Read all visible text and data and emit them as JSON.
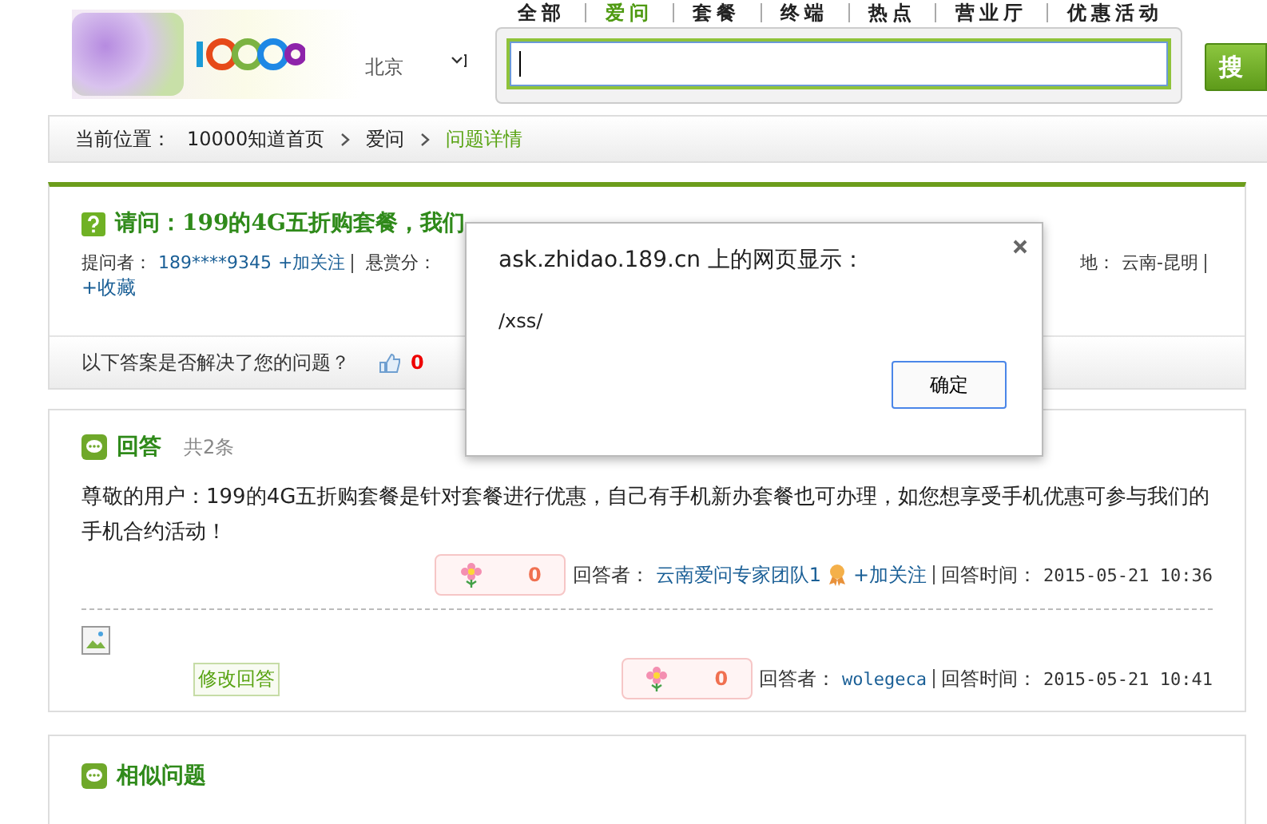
{
  "nav_tabs": [
    {
      "label": "全部",
      "selected": false
    },
    {
      "label": "爱问",
      "selected": true
    },
    {
      "label": "套餐",
      "selected": false
    },
    {
      "label": "终端",
      "selected": false
    },
    {
      "label": "热点",
      "selected": false
    },
    {
      "label": "营业厅",
      "selected": false
    },
    {
      "label": "优惠活动",
      "selected": false
    }
  ],
  "city_select": {
    "value": "北京"
  },
  "search": {
    "button": "搜"
  },
  "breadcrumb": {
    "label": "当前位置：",
    "items": [
      {
        "text": "10000知道首页",
        "current": false
      },
      {
        "text": "爱问",
        "current": false
      },
      {
        "text": "问题详情",
        "current": true
      }
    ]
  },
  "question": {
    "title": "请问：199的4G五折购套餐，我们",
    "asker_label": "提问者：",
    "asker": "189****9345",
    "follow": "+加关注",
    "reward_label": "悬赏分：",
    "location_label": "地：",
    "location": "云南-昆明",
    "favorite": "+收藏",
    "solved_prompt": "以下答案是否解决了您的问题？",
    "likes": "0"
  },
  "answers": {
    "title": "回答",
    "count": "共2条",
    "items": [
      {
        "text": "尊敬的用户：199的4G五折购套餐是针对套餐进行优惠，自己有手机新办套餐也可办理，如您想享受手机优惠可参与我们的手机合约活动！",
        "votes": "0",
        "answerer_label": "回答者：",
        "answerer": "云南爱问专家团队1",
        "badge": true,
        "follow": "+加关注",
        "time_label": "回答时间：",
        "time": "2015-05-21 10:36",
        "broken_image": false
      },
      {
        "votes": "0",
        "answerer_label": "回答者：",
        "answerer": "wolegeca",
        "badge": false,
        "time_label": "回答时间：",
        "time": "2015-05-21 10:41",
        "broken_image": true,
        "edit": "修改回答"
      }
    ]
  },
  "similar": {
    "title": "相似问题"
  },
  "dialog": {
    "title": "ask.zhidao.189.cn 上的网页显示：",
    "message": "/xss/",
    "ok": "确定"
  }
}
